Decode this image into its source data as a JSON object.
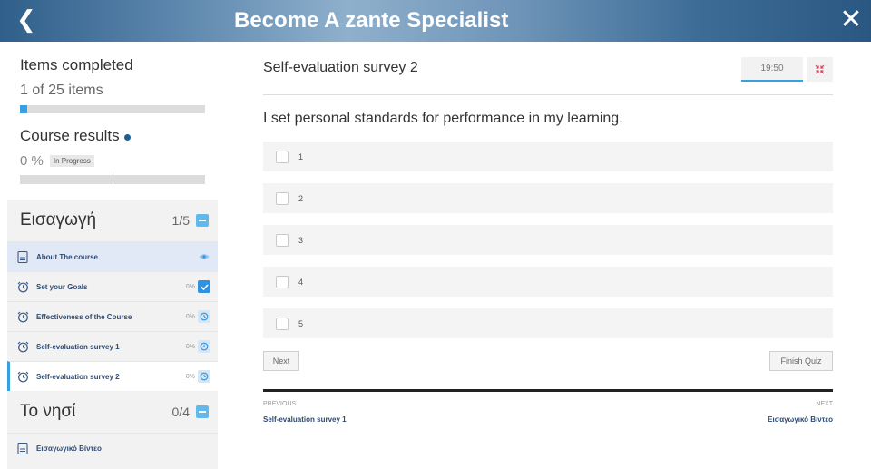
{
  "header": {
    "title": "Become A zante Specialist",
    "back_icon": "chevron-left",
    "close_icon": "close"
  },
  "sidebar": {
    "items_completed_label": "Items completed",
    "items_completed_count": "1 of 25 items",
    "items_progress": 0.04,
    "course_results_label": "Course results",
    "course_results_percent": "0",
    "course_results_unit": "%",
    "course_results_status": "In Progress",
    "sections": [
      {
        "name": "Εισαγωγή",
        "progress": "1/5",
        "lessons": [
          {
            "label": "About The course",
            "icon": "document",
            "percent": "",
            "status": "eye",
            "state": "active"
          },
          {
            "label": "Set your Goals",
            "icon": "alarm-clock",
            "percent": "0%",
            "status": "done",
            "state": ""
          },
          {
            "label": "Effectiveness of the Course",
            "icon": "alarm-clock",
            "percent": "0%",
            "status": "clock",
            "state": ""
          },
          {
            "label": "Self-evaluation survey 1",
            "icon": "alarm-clock",
            "percent": "0%",
            "status": "clock",
            "state": ""
          },
          {
            "label": "Self-evaluation survey 2",
            "icon": "alarm-clock",
            "percent": "0%",
            "status": "clock",
            "state": "current"
          }
        ]
      },
      {
        "name": "Το νησί",
        "progress": "0/4",
        "lessons": [
          {
            "label": "Εισαγωγικό Βίντεο",
            "icon": "document",
            "percent": "",
            "status": "",
            "state": ""
          }
        ]
      }
    ]
  },
  "quiz": {
    "title": "Self-evaluation survey 2",
    "timer": "19:50",
    "question": "I set personal standards for performance in my learning.",
    "options": [
      "1",
      "2",
      "3",
      "4",
      "5"
    ],
    "next_label": "Next",
    "finish_label": "Finish Quiz"
  },
  "footer_nav": {
    "previous_label": "PREVIOUS",
    "previous_link": "Self-evaluation survey 1",
    "next_label": "NEXT",
    "next_link": "Εισαγωγικό Βίντεο"
  },
  "colors": {
    "accent": "#39a0e0",
    "link": "#2e4b72",
    "header": "#4a7aa5"
  }
}
